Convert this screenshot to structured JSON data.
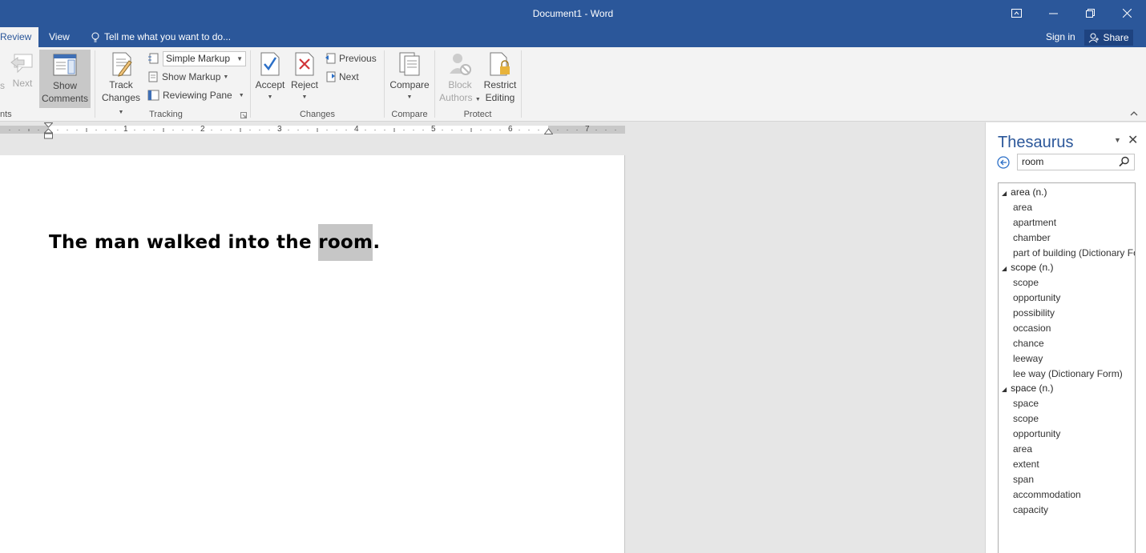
{
  "window": {
    "title": "Document1 - Word",
    "controls": [
      "ribbon-display-icon",
      "minimize-icon",
      "restore-icon",
      "close-icon"
    ]
  },
  "tabs": {
    "review": "Review",
    "view": "View",
    "tellme": "Tell me what you want to do...",
    "signin": "Sign in",
    "share": "Share"
  },
  "ribbon": {
    "comments": {
      "prev_fragment": "s",
      "next": "Next",
      "show_comments_l1": "Show",
      "show_comments_l2": "Comments",
      "group_fragment": "nts"
    },
    "tracking": {
      "track_changes_l1": "Track",
      "track_changes_l2": "Changes",
      "markup_select": "Simple Markup",
      "show_markup": "Show Markup",
      "reviewing_pane": "Reviewing Pane",
      "group": "Tracking"
    },
    "changes": {
      "accept": "Accept",
      "reject": "Reject",
      "previous": "Previous",
      "next": "Next",
      "group": "Changes"
    },
    "compare": {
      "compare": "Compare",
      "group": "Compare"
    },
    "protect": {
      "block_l1": "Block",
      "block_l2": "Authors",
      "restrict_l1": "Restrict",
      "restrict_l2": "Editing",
      "group": "Protect"
    }
  },
  "ruler": {
    "numbers": [
      "1",
      "2",
      "3",
      "4",
      "5",
      "6",
      "7"
    ]
  },
  "document": {
    "text_before": "The man walked into the ",
    "selected_word": "room",
    "text_after": "."
  },
  "thesaurus": {
    "title": "Thesaurus",
    "search_value": "room",
    "groups": [
      {
        "heading": "area (n.)",
        "items": [
          "area",
          "apartment",
          "chamber",
          "part of building (Dictionary Form)"
        ]
      },
      {
        "heading": "scope (n.)",
        "items": [
          "scope",
          "opportunity",
          "possibility",
          "occasion",
          "chance",
          "leeway",
          "lee way (Dictionary Form)"
        ]
      },
      {
        "heading": "space (n.)",
        "items": [
          "space",
          "scope",
          "opportunity",
          "area",
          "extent",
          "span",
          "accommodation",
          "capacity"
        ]
      }
    ]
  }
}
